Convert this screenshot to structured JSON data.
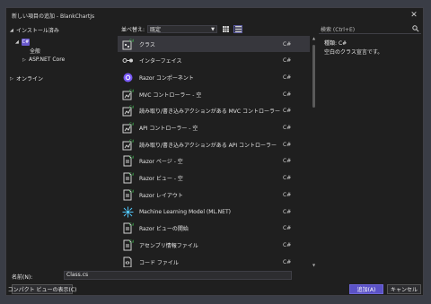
{
  "window": {
    "title": "新しい項目の追加 - BlankChartJs"
  },
  "tree": {
    "installed": "インストール済み",
    "lang_badge": "C#",
    "all": "全般",
    "aspnet": "ASP.NET Core",
    "online": "オンライン"
  },
  "toolbar": {
    "sort_label": "並べ替え:",
    "sort_value": "既定"
  },
  "templates": [
    {
      "name": "クラス",
      "lang": "C#",
      "icon": "class-icon",
      "selected": true
    },
    {
      "name": "インターフェイス",
      "lang": "C#",
      "icon": "interface-icon"
    },
    {
      "name": "Razor コンポーネント",
      "lang": "C#",
      "icon": "razor-component-icon"
    },
    {
      "name": "MVC コントローラー - 空",
      "lang": "C#",
      "icon": "controller-icon"
    },
    {
      "name": "読み取り/書き込みアクションがある MVC コントローラー",
      "lang": "C#",
      "icon": "controller-icon"
    },
    {
      "name": "API コントローラー - 空",
      "lang": "C#",
      "icon": "controller-icon"
    },
    {
      "name": "読み取り/書き込みアクションがある API コントローラー",
      "lang": "C#",
      "icon": "controller-icon"
    },
    {
      "name": "Razor ページ - 空",
      "lang": "C#",
      "icon": "page-icon"
    },
    {
      "name": "Razor ビュー - 空",
      "lang": "C#",
      "icon": "page-icon"
    },
    {
      "name": "Razor レイアウト",
      "lang": "C#",
      "icon": "page-icon"
    },
    {
      "name": "Machine Learning Model (ML.NET)",
      "lang": "C#",
      "icon": "ml-icon"
    },
    {
      "name": "Razor ビューの開始",
      "lang": "C#",
      "icon": "page-icon"
    },
    {
      "name": "アセンブリ情報ファイル",
      "lang": "C#",
      "icon": "page-icon"
    },
    {
      "name": "コード ファイル",
      "lang": "C#",
      "icon": "code-file-icon"
    }
  ],
  "search": {
    "placeholder": "検索 (Ctrl+E)"
  },
  "details": {
    "type_label": "種類:",
    "type_value": "C#",
    "description": "空白のクラス宣言です。"
  },
  "bottom": {
    "name_label": "名前(N):",
    "name_value": "Class.cs",
    "compact_button": "コンパクト ビューの表示(C)",
    "add_button": "追加(A)",
    "cancel_button": "キャンセル"
  },
  "colors": {
    "accent": "#5b52c7",
    "background": "#1f1f1f",
    "selected_row": "#37373d"
  }
}
